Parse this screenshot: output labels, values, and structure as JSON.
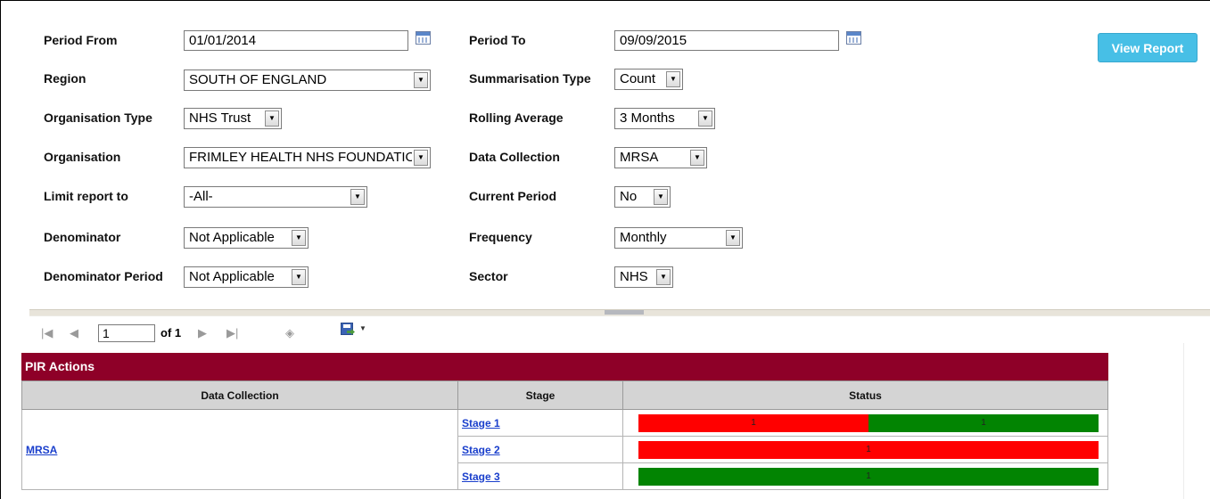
{
  "filters": {
    "period_from": {
      "label": "Period From",
      "value": "01/01/2014"
    },
    "period_to": {
      "label": "Period To",
      "value": "09/09/2015"
    },
    "region": {
      "label": "Region",
      "value": "SOUTH OF ENGLAND"
    },
    "summarisation_type": {
      "label": "Summarisation Type",
      "value": "Count"
    },
    "organisation_type": {
      "label": "Organisation Type",
      "value": "NHS Trust"
    },
    "rolling_average": {
      "label": "Rolling Average",
      "value": "3 Months"
    },
    "organisation": {
      "label": "Organisation",
      "value": "FRIMLEY HEALTH NHS FOUNDATION TRUST"
    },
    "data_collection": {
      "label": "Data Collection",
      "value": "MRSA"
    },
    "limit_report_to": {
      "label": "Limit report to",
      "value": "-All-"
    },
    "current_period": {
      "label": "Current Period",
      "value": "No"
    },
    "denominator": {
      "label": "Denominator",
      "value": "Not Applicable"
    },
    "frequency": {
      "label": "Frequency",
      "value": "Monthly"
    },
    "denominator_period": {
      "label": "Denominator Period",
      "value": "Not Applicable"
    },
    "sector": {
      "label": "Sector",
      "value": "NHS"
    }
  },
  "view_report_label": "View Report",
  "toolbar": {
    "first_icon": "first-page-icon",
    "prev_icon": "previous-page-icon",
    "page": "1",
    "of_text": "of 1",
    "next_icon": "next-page-icon",
    "last_icon": "last-page-icon",
    "back_icon": "back-icon",
    "export_icon": "save-export-icon"
  },
  "report": {
    "title": "PIR Actions",
    "columns": [
      "Data Collection",
      "Stage",
      "Status"
    ],
    "data_collection": "MRSA",
    "stages": [
      {
        "label": "Stage 1",
        "segments": [
          {
            "color": "red",
            "value": "1"
          },
          {
            "color": "green",
            "value": "1"
          }
        ]
      },
      {
        "label": "Stage 2",
        "segments": [
          {
            "color": "red",
            "value": "1"
          }
        ]
      },
      {
        "label": "Stage 3",
        "segments": [
          {
            "color": "green",
            "value": "1"
          }
        ]
      }
    ]
  },
  "colors": {
    "header_bar": "#8e0028",
    "button": "#47bfe6",
    "status_red": "#ff0000",
    "status_green": "#028402",
    "link": "#1a3fcc"
  }
}
